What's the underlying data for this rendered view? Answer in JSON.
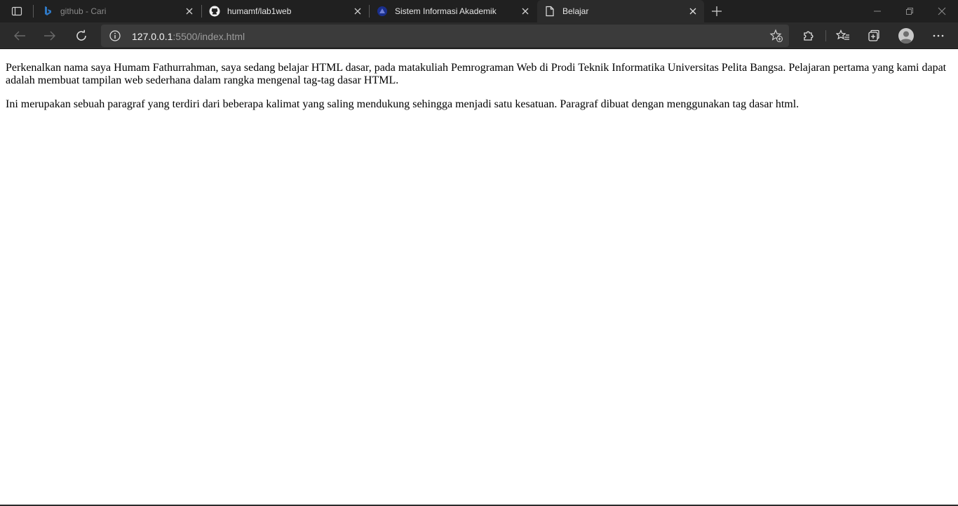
{
  "tabs": [
    {
      "title": "github - Cari",
      "favicon": "bing-icon"
    },
    {
      "title": "humamf/lab1web",
      "favicon": "github-icon"
    },
    {
      "title": "Sistem Informasi Akademik",
      "favicon": "university-icon"
    },
    {
      "title": "Belajar",
      "favicon": "page-icon"
    }
  ],
  "address": {
    "host": "127.0.0.1",
    "rest": ":5500/index.html"
  },
  "page": {
    "paragraph1": "Perkenalkan nama saya Humam Fathurrahman, saya sedang belajar HTML dasar, pada matakuliah Pemrograman Web di Prodi Teknik Informatika Universitas Pelita Bangsa. Pelajaran pertama yang kami dapat adalah membuat tampilan web sederhana dalam rangka mengenal tag-tag dasar HTML.",
    "paragraph2": "Ini merupakan sebuah paragraf yang terdiri dari beberapa kalimat yang saling mendukung sehingga menjadi satu kesatuan. Paragraf dibuat dengan menggunakan tag dasar html."
  },
  "colors": {
    "tabstrip_bg": "#202020",
    "toolbar_bg": "#2b2b2b",
    "address_bg": "#3b3b3b",
    "page_bg": "#ffffff"
  }
}
